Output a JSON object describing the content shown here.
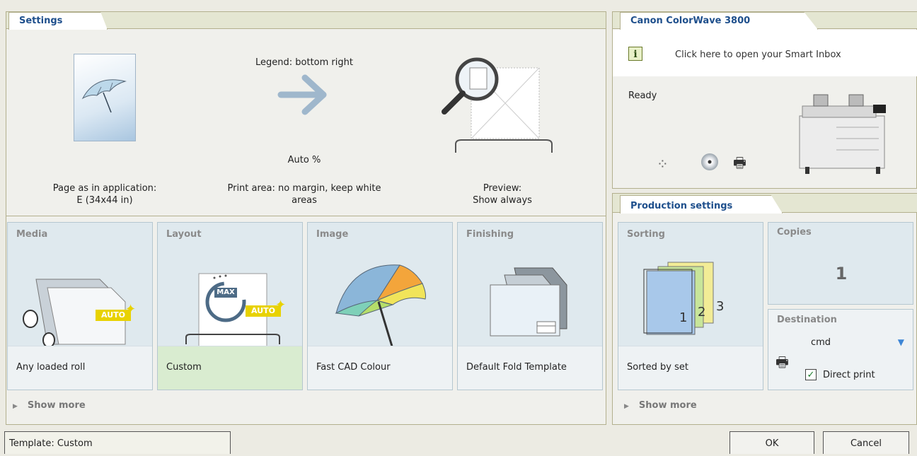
{
  "settings": {
    "tab_label": "Settings",
    "page": {
      "line1": "Page as in application:",
      "line2": "E (34x44 in)"
    },
    "legend": "Legend: bottom right",
    "auto_percent": "Auto %",
    "print_area": {
      "line1": "Print area: no margin, keep white",
      "line2": "areas"
    },
    "preview": {
      "line1": "Preview:",
      "line2": "Show always"
    }
  },
  "cards": [
    {
      "title": "Media",
      "value": "Any loaded roll",
      "badge": "AUTO"
    },
    {
      "title": "Layout",
      "value": "Custom",
      "badge": "AUTO",
      "max": "MAX"
    },
    {
      "title": "Image",
      "value": "Fast CAD Colour"
    },
    {
      "title": "Finishing",
      "value": "Default Fold Template"
    }
  ],
  "show_more_label": "Show more",
  "printer": {
    "tab_label": "Canon ColorWave 3800",
    "inbox_text": "Click here to open your Smart Inbox",
    "info_icon_glyph": "i",
    "status": "Ready"
  },
  "production": {
    "tab_label": "Production settings",
    "sorting": {
      "title": "Sorting",
      "value": "Sorted by set",
      "pages": [
        "1",
        "2",
        "3"
      ]
    },
    "copies": {
      "title": "Copies",
      "value": "1"
    },
    "destination": {
      "title": "Destination",
      "value": "cmd",
      "direct_print_label": "Direct print",
      "direct_print_checked": true
    }
  },
  "footer": {
    "template": "Template: Custom",
    "ok": "OK",
    "cancel": "Cancel"
  },
  "colors": {
    "tab_text": "#1e4f8c",
    "auto_badge": "#e8d200",
    "selected_card_footer": "#d9ecd0"
  }
}
